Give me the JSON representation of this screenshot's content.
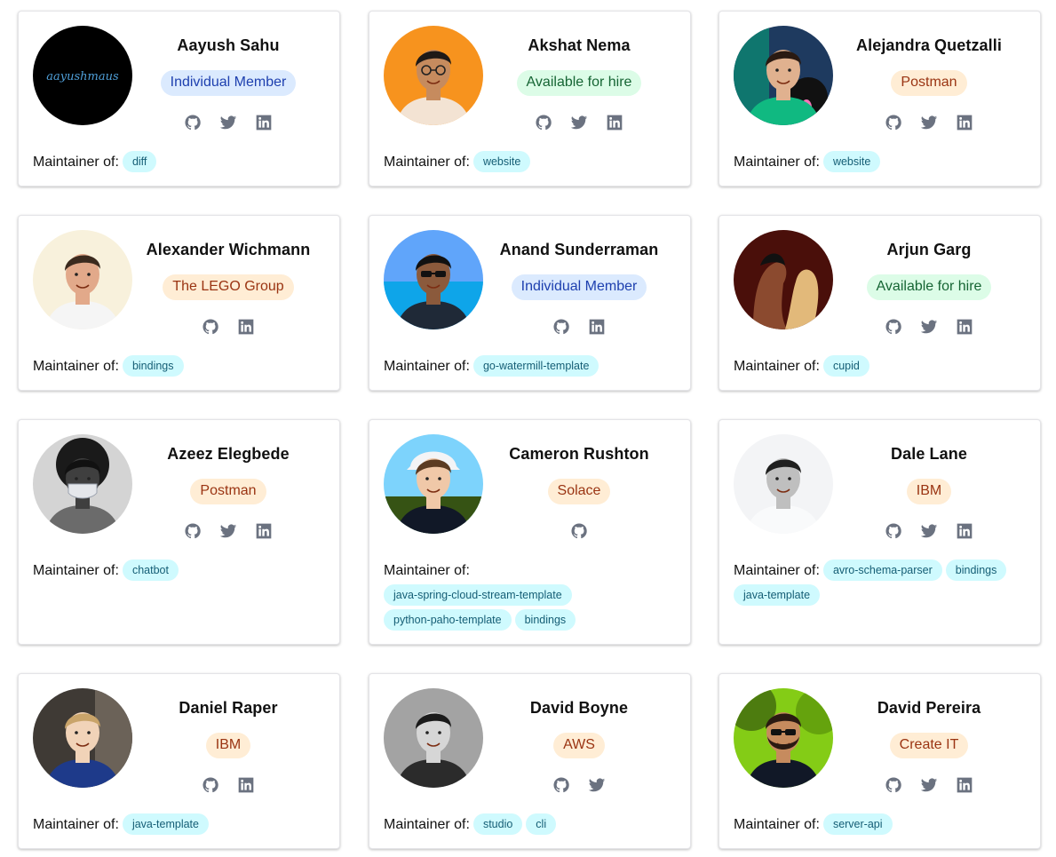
{
  "maintainer_label": "Maintainer of:",
  "colors": {
    "card_border": "#e4e4e7",
    "tag_bg": "#cffafe",
    "tag_text": "#155e75",
    "badge_blue_bg": "#dbeafe",
    "badge_blue_text": "#1e40af",
    "badge_green_bg": "#dcfce7",
    "badge_green_text": "#166534",
    "badge_orange_bg": "#ffedd5",
    "badge_orange_text": "#9a3412",
    "icon_gray": "#6b7280"
  },
  "cards": [
    {
      "name": "Aayush Sahu",
      "badge": "Individual Member",
      "badge_color": "blue",
      "socials": [
        "github-icon",
        "twitter-icon",
        "linkedin-icon"
      ],
      "tags": [
        "diff"
      ]
    },
    {
      "name": "Akshat Nema",
      "badge": "Available for hire",
      "badge_color": "green",
      "socials": [
        "github-icon",
        "twitter-icon",
        "linkedin-icon"
      ],
      "tags": [
        "website"
      ]
    },
    {
      "name": "Alejandra Quetzalli",
      "badge": "Postman",
      "badge_color": "orange",
      "socials": [
        "github-icon",
        "twitter-icon",
        "linkedin-icon"
      ],
      "tags": [
        "website"
      ]
    },
    {
      "name": "Alexander Wichmann",
      "badge": "The LEGO Group",
      "badge_color": "orange",
      "socials": [
        "github-icon",
        "linkedin-icon"
      ],
      "tags": [
        "bindings"
      ]
    },
    {
      "name": "Anand Sunderraman",
      "badge": "Individual Member",
      "badge_color": "blue",
      "socials": [
        "github-icon",
        "linkedin-icon"
      ],
      "tags": [
        "go-watermill-template"
      ]
    },
    {
      "name": "Arjun Garg",
      "badge": "Available for hire",
      "badge_color": "green",
      "socials": [
        "github-icon",
        "twitter-icon",
        "linkedin-icon"
      ],
      "tags": [
        "cupid"
      ]
    },
    {
      "name": "Azeez Elegbede",
      "badge": "Postman",
      "badge_color": "orange",
      "socials": [
        "github-icon",
        "twitter-icon",
        "linkedin-icon"
      ],
      "tags": [
        "chatbot"
      ]
    },
    {
      "name": "Cameron Rushton",
      "badge": "Solace",
      "badge_color": "orange",
      "socials": [
        "github-icon"
      ],
      "tags": [
        "java-spring-cloud-stream-template",
        "python-paho-template",
        "bindings"
      ]
    },
    {
      "name": "Dale Lane",
      "badge": "IBM",
      "badge_color": "orange",
      "socials": [
        "github-icon",
        "twitter-icon",
        "linkedin-icon"
      ],
      "tags": [
        "avro-schema-parser",
        "bindings",
        "java-template"
      ]
    },
    {
      "name": "Daniel Raper",
      "badge": "IBM",
      "badge_color": "orange",
      "socials": [
        "github-icon",
        "linkedin-icon"
      ],
      "tags": [
        "java-template"
      ]
    },
    {
      "name": "David Boyne",
      "badge": "AWS",
      "badge_color": "orange",
      "socials": [
        "github-icon",
        "twitter-icon"
      ],
      "tags": [
        "studio",
        "cli"
      ]
    },
    {
      "name": "David Pereira",
      "badge": "Create IT",
      "badge_color": "orange",
      "socials": [
        "github-icon",
        "twitter-icon",
        "linkedin-icon"
      ],
      "tags": [
        "server-api"
      ]
    }
  ]
}
